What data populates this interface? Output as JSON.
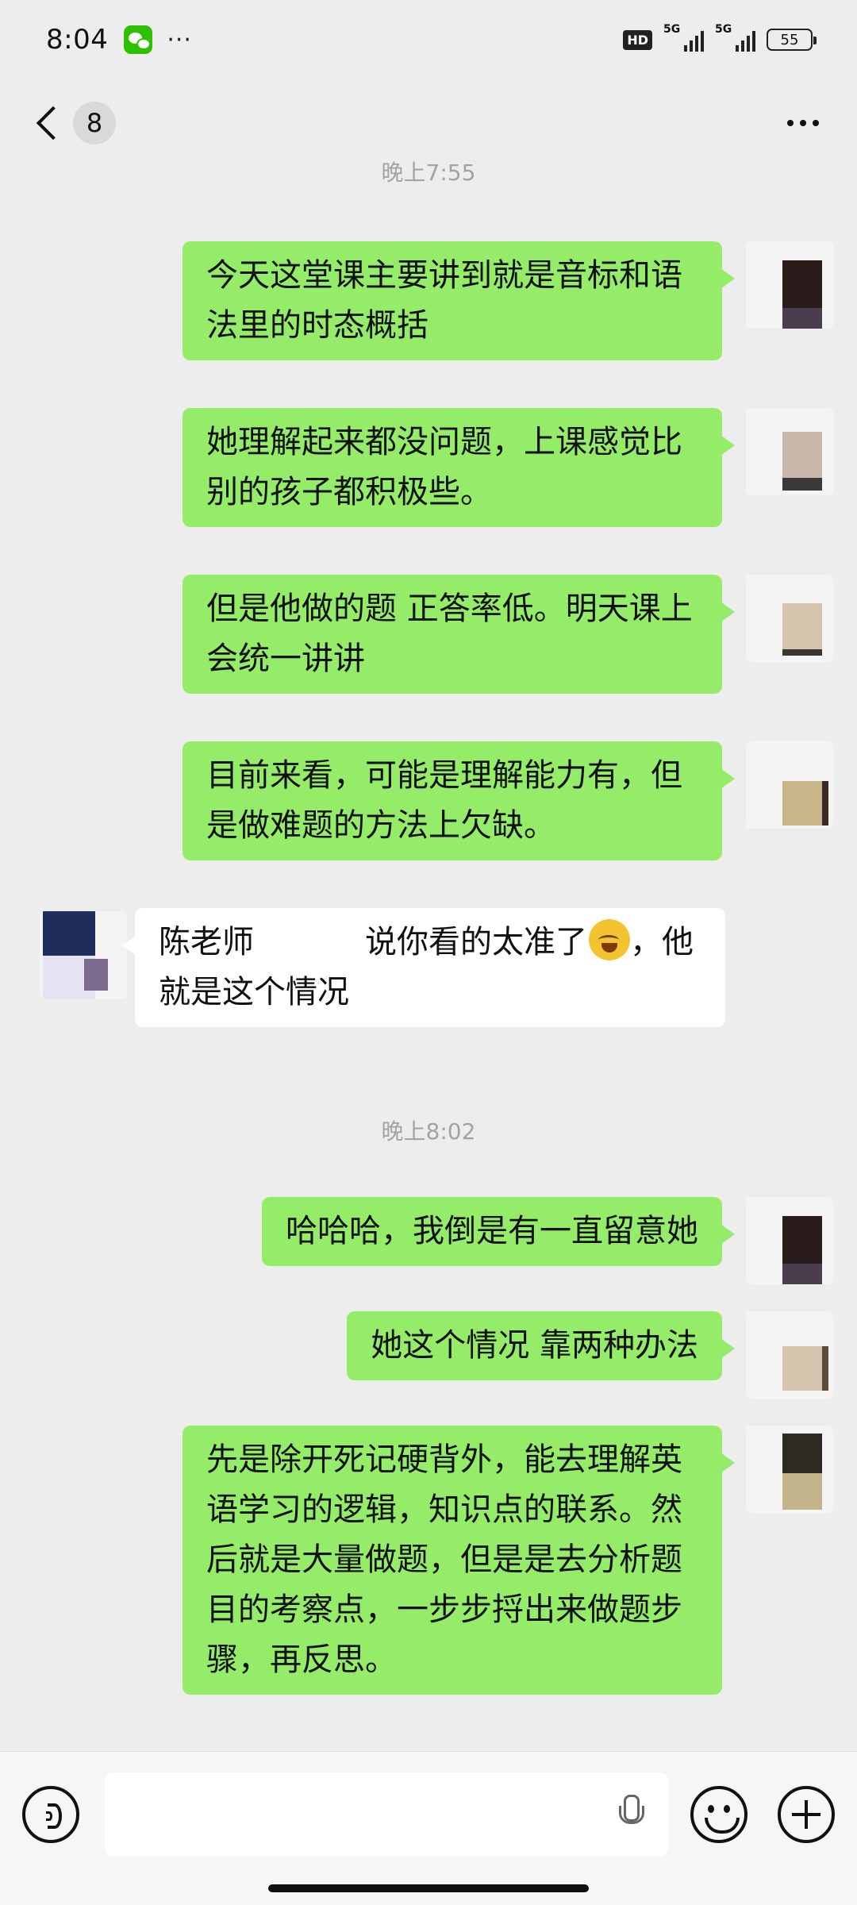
{
  "status_bar": {
    "time": "8:04",
    "more": "···",
    "hd": "HD",
    "signal1": "5G",
    "signal2": "5G",
    "battery": "55"
  },
  "nav": {
    "unread_count": "8"
  },
  "chat": {
    "timestamps": [
      "晚上7:55",
      "晚上8:02"
    ],
    "messages": [
      {
        "from": "me",
        "text": "今天这堂课主要讲到就是音标和语法里的时态概括"
      },
      {
        "from": "me",
        "text": "她理解起来都没问题，上课感觉比别的孩子都积极些。"
      },
      {
        "from": "me",
        "text": "但是他做的题 正答率低。明天课上会统一讲讲"
      },
      {
        "from": "me",
        "text": "目前来看，可能是理解能力有，但是做难题的方法上欠缺。"
      },
      {
        "from": "other",
        "text_before": "陈老师",
        "text_after": "说你看的太准了",
        "text_end": "，他就是这个情况",
        "emoji": "laughing-tears-emoji"
      },
      {
        "from": "me",
        "text": "哈哈哈，我倒是有一直留意她"
      },
      {
        "from": "me",
        "text": "她这个情况 靠两种办法"
      },
      {
        "from": "me",
        "text": "先是除开死记硬背外，能去理解英语学习的逻辑，知识点的联系。然后就是大量做题，但是是去分析题目的考察点，一步步捋出来做题步骤，再反思。"
      }
    ]
  },
  "icons": {
    "back": "chevron-left-icon",
    "more": "more-dots-icon",
    "voice": "voice-icon",
    "mic": "mic-icon",
    "emoji": "smiley-icon",
    "plus": "plus-icon"
  },
  "colors": {
    "background": "#ededed",
    "my_bubble": "#95ec69",
    "other_bubble": "#ffffff",
    "timestamp": "#a3a3a3"
  }
}
